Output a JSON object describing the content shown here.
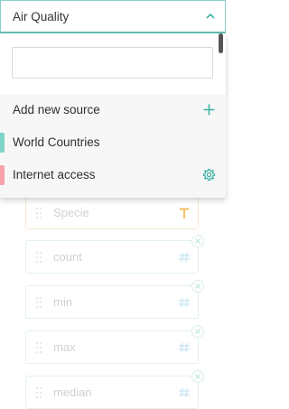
{
  "select": {
    "value": "Air Quality",
    "icon": "chevron-up-icon"
  },
  "search": {
    "value": "",
    "placeholder": ""
  },
  "sources": {
    "add_label": "Add new source",
    "items": [
      {
        "label": "World Countries",
        "color": "#7fd3c6"
      },
      {
        "label": "Internet access",
        "color": "#f5a3a8",
        "icon": "gear-icon"
      }
    ]
  },
  "fields": [
    {
      "label": "Specie",
      "type_icon": "text-type-icon"
    },
    {
      "label": "count",
      "type_icon": "numeric-type-icon"
    },
    {
      "label": "min",
      "type_icon": "numeric-type-icon"
    },
    {
      "label": "max",
      "type_icon": "numeric-type-icon"
    },
    {
      "label": "median",
      "type_icon": "numeric-type-icon"
    }
  ],
  "colors": {
    "accent": "#3fb3a5",
    "specie_icon": "#f3c46b"
  }
}
